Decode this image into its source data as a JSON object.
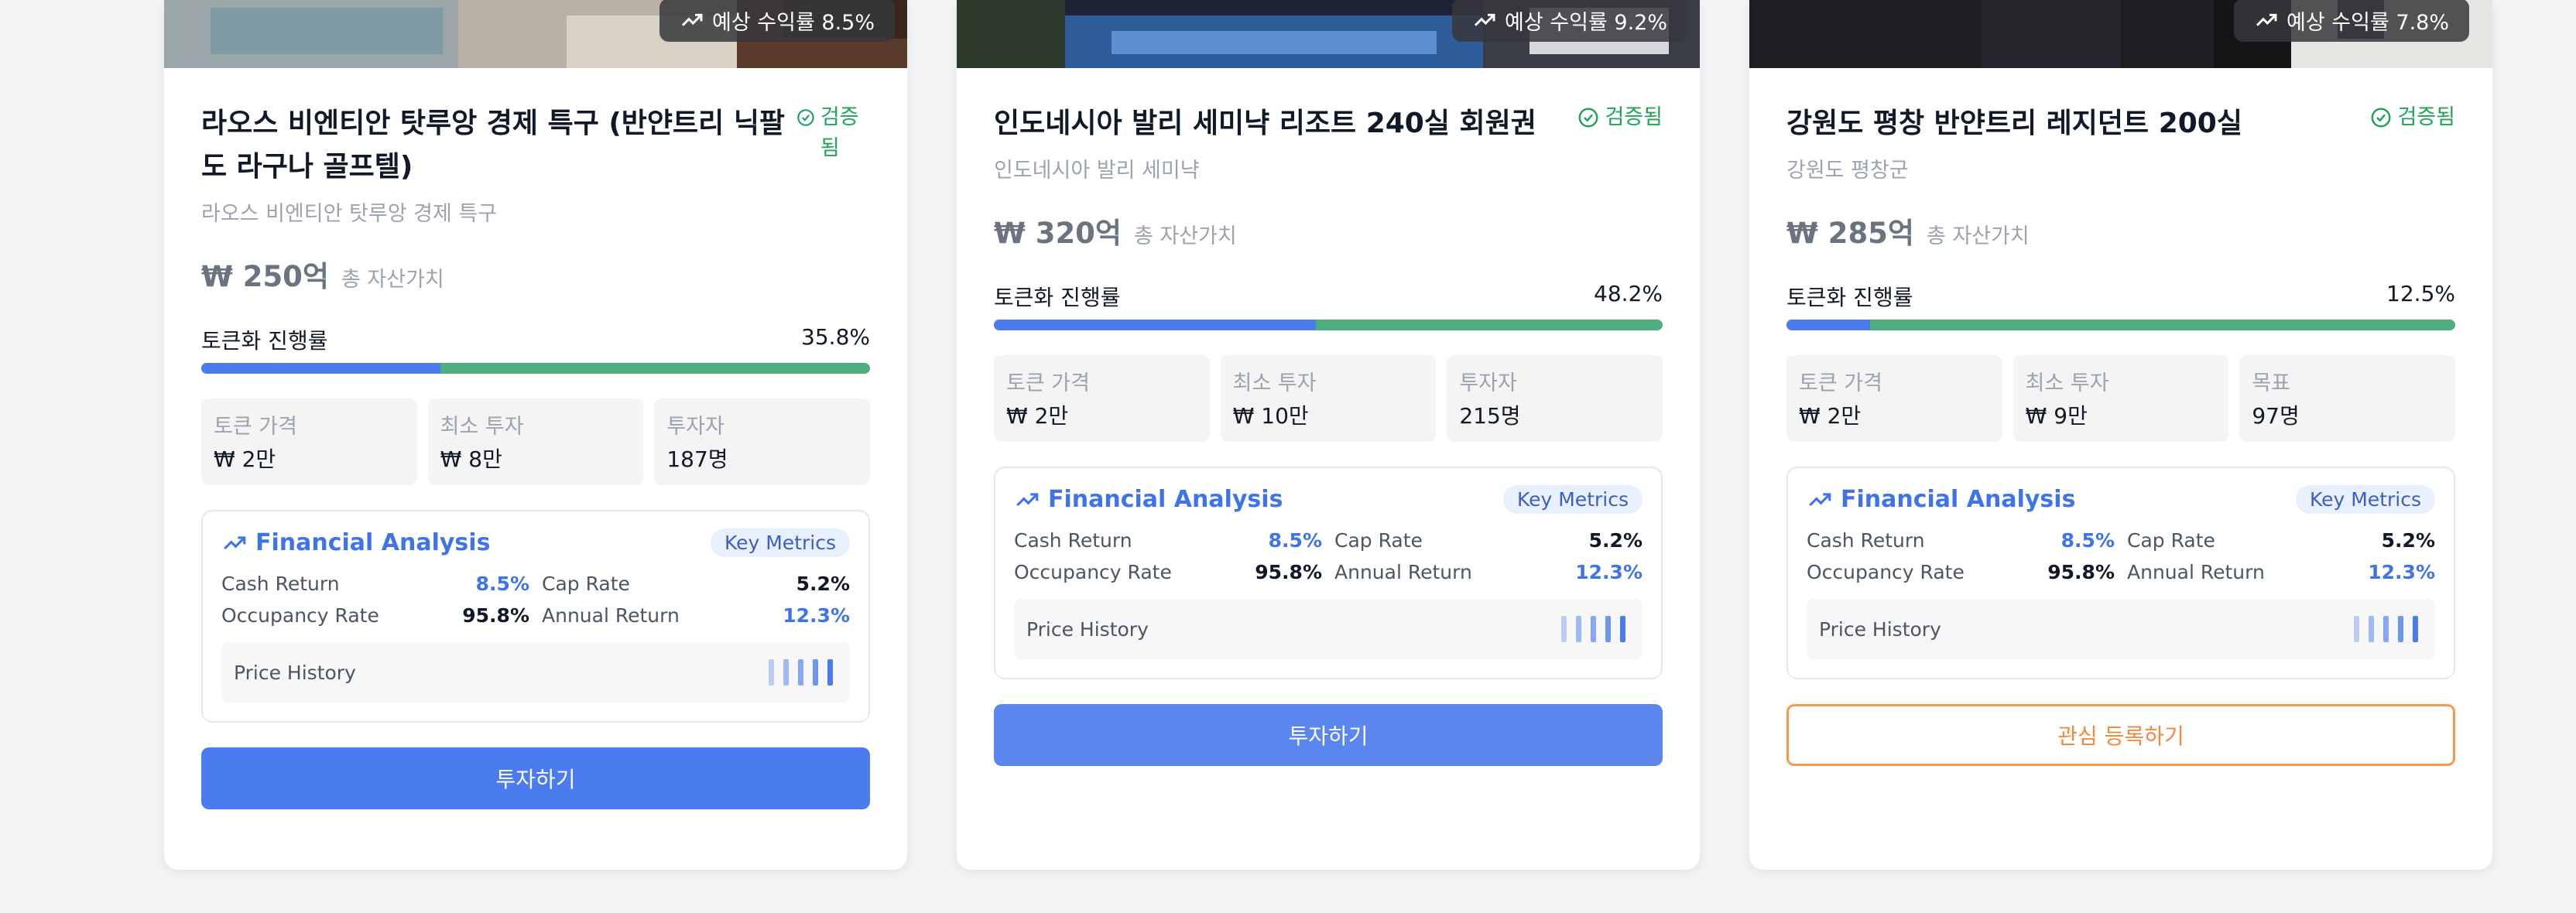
{
  "cards": [
    {
      "yield": "예상 수익률 8.5%",
      "verified": "검증됨",
      "title": "라오스 비엔티안 탓루앙 경제 특구 (반얀트리 닉팔도 라구나 골프텔)",
      "location": "라오스 비엔티안 탓루앙 경제 특구",
      "value": "₩ 250억",
      "value_label": "총 자산가치",
      "progress_label": "토큰화 진행률",
      "progress_text": "35.8%",
      "progress": 35.8,
      "stats": [
        {
          "label": "토큰 가격",
          "value": "₩ 2만"
        },
        {
          "label": "최소 투자",
          "value": "₩ 8만"
        },
        {
          "label": "투자자",
          "value": "187명"
        }
      ],
      "fa_title": "Financial Analysis",
      "fa_badge": "Key Metrics",
      "metrics": [
        {
          "label": "Cash Return",
          "value": "8.5%"
        },
        {
          "label": "Cap Rate",
          "value": "5.2%"
        },
        {
          "label": "Occupancy Rate",
          "value": "95.8%"
        },
        {
          "label": "Annual Return",
          "value": "12.3%"
        }
      ],
      "price_history": "Price History",
      "button": "투자하기"
    },
    {
      "yield": "예상 수익률 9.2%",
      "verified": "검증됨",
      "title": "인도네시아 발리 세미냑 리조트 240실 회원권",
      "location": "인도네시아 발리 세미냑",
      "value": "₩ 320억",
      "value_label": "총 자산가치",
      "progress_label": "토큰화 진행률",
      "progress_text": "48.2%",
      "progress": 48.2,
      "stats": [
        {
          "label": "토큰 가격",
          "value": "₩ 2만"
        },
        {
          "label": "최소 투자",
          "value": "₩ 10만"
        },
        {
          "label": "투자자",
          "value": "215명"
        }
      ],
      "fa_title": "Financial Analysis",
      "fa_badge": "Key Metrics",
      "metrics": [
        {
          "label": "Cash Return",
          "value": "8.5%"
        },
        {
          "label": "Cap Rate",
          "value": "5.2%"
        },
        {
          "label": "Occupancy Rate",
          "value": "95.8%"
        },
        {
          "label": "Annual Return",
          "value": "12.3%"
        }
      ],
      "price_history": "Price History",
      "button": "투자하기"
    },
    {
      "yield": "예상 수익률 7.8%",
      "verified": "검증됨",
      "title": "강원도 평창 반얀트리 레지던트 200실",
      "location": "강원도 평창군",
      "value": "₩ 285억",
      "value_label": "총 자산가치",
      "progress_label": "토큰화 진행률",
      "progress_text": "12.5%",
      "progress": 12.5,
      "stats": [
        {
          "label": "토큰 가격",
          "value": "₩ 2만"
        },
        {
          "label": "최소 투자",
          "value": "₩ 9만"
        },
        {
          "label": "목표",
          "value": "97명"
        }
      ],
      "fa_title": "Financial Analysis",
      "fa_badge": "Key Metrics",
      "metrics": [
        {
          "label": "Cash Return",
          "value": "8.5%"
        },
        {
          "label": "Cap Rate",
          "value": "5.2%"
        },
        {
          "label": "Occupancy Rate",
          "value": "95.8%"
        },
        {
          "label": "Annual Return",
          "value": "12.3%"
        }
      ],
      "price_history": "Price History",
      "button": "관심 등록하기"
    }
  ],
  "colors": {
    "primary": "#4a7cf0",
    "success": "#22a35a",
    "progress_track": "#4caf7d",
    "outline_orange": "#f59a4c"
  }
}
